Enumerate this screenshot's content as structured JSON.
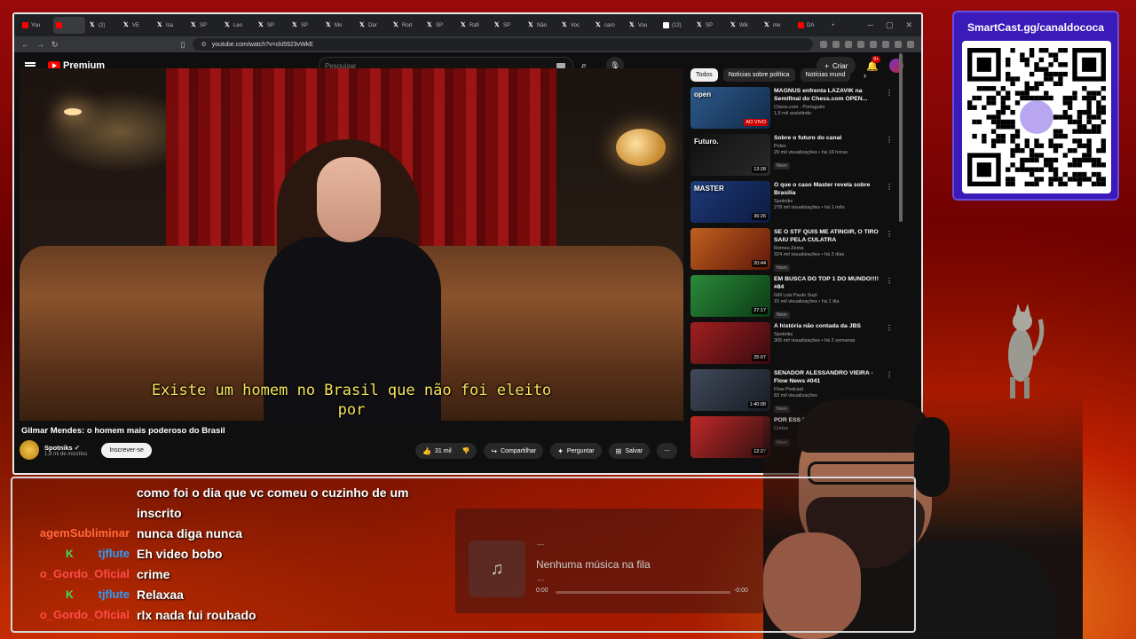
{
  "browser": {
    "tabs": [
      {
        "label": "You",
        "fav": "yt"
      },
      {
        "label": "",
        "fav": "yt"
      },
      {
        "label": "(2)",
        "fav": "x"
      },
      {
        "label": "VE",
        "fav": "x"
      },
      {
        "label": "Isa",
        "fav": "x"
      },
      {
        "label": "SP",
        "fav": "x"
      },
      {
        "label": "Leo",
        "fav": "x"
      },
      {
        "label": "SP",
        "fav": "x"
      },
      {
        "label": "SP",
        "fav": "x"
      },
      {
        "label": "Mo",
        "fav": "x"
      },
      {
        "label": "Dar",
        "fav": "x"
      },
      {
        "label": "Rod",
        "fav": "x"
      },
      {
        "label": "SP",
        "fav": "x"
      },
      {
        "label": "Rafi",
        "fav": "x"
      },
      {
        "label": "SP",
        "fav": "x"
      },
      {
        "label": "Não",
        "fav": "x"
      },
      {
        "label": "Voc",
        "fav": "x"
      },
      {
        "label": "caro",
        "fav": "x"
      },
      {
        "label": "Vou",
        "fav": "x"
      },
      {
        "label": "(12)",
        "fav": "tt"
      },
      {
        "label": "SP",
        "fav": "x"
      },
      {
        "label": "Wik",
        "fav": "x"
      },
      {
        "label": "me",
        "fav": "x"
      },
      {
        "label": "DA",
        "fav": "yt"
      }
    ],
    "url": "youtube.com/watch?v=cki5923vWkE"
  },
  "youtube": {
    "logo_text": "Premium",
    "search_placeholder": "Pesquisar",
    "create_label": "Criar",
    "notif_count": "9+"
  },
  "video": {
    "subtitle_line1": "Existe um homem no Brasil que não foi eleito",
    "subtitle_line2": "por",
    "title": "Gilmar Mendes: o homem mais poderoso do Brasil",
    "channel": "Spotniks",
    "subscribers": "1,8 mi de inscritos",
    "subscribe_label": "Inscrever-se",
    "likes": "31 mil",
    "share_label": "Compartilhar",
    "ask_label": "Perguntar",
    "save_label": "Salvar"
  },
  "chips": [
    "Todos",
    "Notícias sobre política",
    "Notícias mund"
  ],
  "recommendations": [
    {
      "title": "MAGNUS enfrenta LAZAVIK na Semifinal do Chess.com OPEN...",
      "channel": "Chess.com - Português",
      "meta": "1,5 mil assistindo",
      "badge": "",
      "duration": "",
      "live": "AO VIVO",
      "caption": "open",
      "color1": "#2e5a8c",
      "color2": "#112a48"
    },
    {
      "title": "Sobre o futuro do canal",
      "channel": "Polex",
      "meta": "29 mil visualizações • há 16 horas",
      "badge": "Novo",
      "duration": "13:28",
      "live": "",
      "caption": "Futuro.",
      "color1": "#101010",
      "color2": "#2a2a2a"
    },
    {
      "title": "O que o caso Master revela sobre Brasília",
      "channel": "Spotniks",
      "meta": "278 mil visualizações • há 1 mês",
      "badge": "",
      "duration": "36:26",
      "live": "",
      "caption": "MASTER",
      "color1": "#1e3a78",
      "color2": "#0c1a40"
    },
    {
      "title": "SE O STF QUIS ME ATINGIR, O TIRO SAIU PELA CULATRA",
      "channel": "Romeu Zema",
      "meta": "324 mil visualizações • há 2 dias",
      "badge": "Novo",
      "duration": "20:44",
      "live": "",
      "caption": "",
      "color1": "#c06020",
      "color2": "#601808"
    },
    {
      "title": "EM BUSCA DO TOP 1 DO MUNDO!!!! #84",
      "channel": "GM Luis Paulo Supi",
      "meta": "15 mil visualizações • há 1 dia",
      "badge": "Novo",
      "duration": "27:17",
      "live": "",
      "caption": "",
      "color1": "#2a8a3a",
      "color2": "#0c3a14"
    },
    {
      "title": "A história não contada da JBS",
      "channel": "Spotniks",
      "meta": "365 mil visualizações • há 2 semanas",
      "badge": "",
      "duration": "25:07",
      "live": "",
      "caption": "",
      "color1": "#a02020",
      "color2": "#3a0a10"
    },
    {
      "title": "SENADOR ALESSANDRO VIEIRA - Flow News #041",
      "channel": "Flow Podcast",
      "meta": "83 mil visualizações",
      "badge": "Novo",
      "duration": "1:40:08",
      "live": "",
      "caption": "",
      "color1": "#404a5a",
      "color2": "#181c24"
    },
    {
      "title": "POR ESS ESPERA",
      "channel": "Cortes",
      "meta": "",
      "badge": "Novo",
      "duration": "12:27",
      "live": "",
      "caption": "",
      "color1": "#c02828",
      "color2": "#301010"
    }
  ],
  "qr": {
    "title": "SmartCast.gg/canaldococa"
  },
  "chat": [
    {
      "user": "",
      "user_color": "#ffffff",
      "badge": "",
      "message": "como foi o dia que vc comeu o cuzinho de um"
    },
    {
      "user": "",
      "user_color": "#ffffff",
      "badge": "",
      "message": "inscrito"
    },
    {
      "user": "agemSubliminar",
      "user_color": "#ff6a3a",
      "badge": "",
      "message": "nunca diga nunca"
    },
    {
      "user": "tjflute",
      "user_color": "#2a9dff",
      "badge": "K",
      "message": "Eh video bobo"
    },
    {
      "user": "o_Gordo_Oficial",
      "user_color": "#ff4a4a",
      "badge": "",
      "message": "crime"
    },
    {
      "user": "tjflute",
      "user_color": "#2a9dff",
      "badge": "K",
      "message": "Relaxaa"
    },
    {
      "user": "o_Gordo_Oficial",
      "user_color": "#ff4a4a",
      "badge": "",
      "message": "rlx nada fui roubado"
    }
  ],
  "music": {
    "top": "---",
    "title": "Nenhuma música na fila",
    "sub": "---",
    "time_start": "0:00",
    "time_end": "-0:00"
  }
}
